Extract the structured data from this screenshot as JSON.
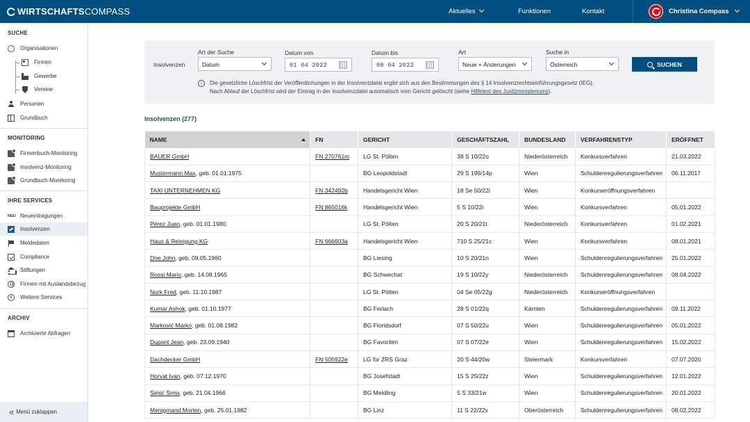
{
  "app": {
    "logo_bold": "WIRTSCHAFTS",
    "logo_light": "COMPASS"
  },
  "topnav": {
    "aktuelles": "Aktuelles",
    "funktionen": "Funktionen",
    "kontakt": "Kontakt",
    "user_name": "Christina Compass"
  },
  "sidebar": {
    "suche_head": "SUCHE",
    "organisationen": "Organisationen",
    "firmen": "Firmen",
    "gewerbe": "Gewerbe",
    "vereine": "Vereine",
    "personen": "Personen",
    "grundbuch": "Grundbuch",
    "monitoring_head": "MONITORING",
    "firmenbuch_monitoring": "Firmenbuch-Monitoring",
    "insolvenz_monitoring": "Insolvenz-Monitoring",
    "grundbuch_monitoring": "Grundbuch-Monitoring",
    "services_head": "IHRE SERVICES",
    "neu_badge": "NEU",
    "neueintragungen": "Neueintragungen",
    "insolvenzen": "Insolvenzen",
    "meldedaten": "Meldedaten",
    "compliance": "Compliance",
    "stiftungen": "Stiftungen",
    "auslandsbezug": "Firmen mit Auslandsbezug",
    "weitere": "Weitere Services",
    "archiv_head": "ARCHIV",
    "archivierte": "Archivierte Abfragen",
    "collapse": "Menü zuklappen"
  },
  "search": {
    "panel_label": "Insolvenzen",
    "art_der_suche_label": "Art der Suche",
    "art_der_suche_value": "Datum",
    "datum_von_label": "Datum von",
    "datum_von_value": "01  04  2022",
    "datum_bis_label": "Datum bis",
    "datum_bis_value": "08  04  2022",
    "art_label": "Art",
    "art_value": "Neue + Änderungen",
    "suche_in_label": "Suche in",
    "suche_in_value": "Österreich",
    "button": "SUCHEN",
    "info_line1": "Die gesetzliche Löschfrist der Veröffentlichungen in der Insolvenzdatei ergibt sich aus den Bestimmungen des § 14 Insolvenzrechtseinführungsgesetz (IEG).",
    "info_line2_prefix": "Nach Ablauf der Löschfrist wird der Eintrag in der Insolvenzdatei automatisch vom Gericht gelöscht (siehe ",
    "info_link": "Hilfetext des Justizministeriums",
    "info_line2_suffix": ")."
  },
  "results": {
    "title": "Insolvenzen (277)",
    "columns": [
      "NAME",
      "FN",
      "GERICHT",
      "GESCHÄFTSZAHL",
      "BUNDESLAND",
      "VERFAHRENSTYP",
      "ERÖFFNET"
    ],
    "rows": [
      {
        "name": "BAUER GmbH",
        "name_suffix": "",
        "fn": "FN 270761m",
        "gericht": "LG St. Pölten",
        "gz": "38 S 10/22o",
        "bl": "Niederösterreich",
        "typ": "Konkursverfahren",
        "date": "21.03.2022"
      },
      {
        "name": "Mustermann Max",
        "name_suffix": ", geb. 01.01.1975",
        "fn": "",
        "gericht": "BG Leopoldstadt",
        "gz": "29 S 199/14p",
        "bl": "Wien",
        "typ": "Schuldenregulierungsverfahren",
        "date": "06.11.2017"
      },
      {
        "name": "TAXI UNTERNEHMEN KG",
        "name_suffix": "",
        "fn": "FN 342492b",
        "gericht": "Handelsgericht Wien",
        "gz": "18 Se 50/22i",
        "bl": "Wien",
        "typ": "Konkurseröffnungsverfahren",
        "date": ""
      },
      {
        "name": "Bauprojekte GmbH",
        "name_suffix": "",
        "fn": "FN 865016k",
        "gericht": "Handelsgericht Wien",
        "gz": "5 S 10/22i",
        "bl": "Wien",
        "typ": "Konkursverfahren",
        "date": "05.01.2022"
      },
      {
        "name": "Pérez Juan",
        "name_suffix": ", geb. 01.01.1980",
        "fn": "",
        "gericht": "LG St. Pölten",
        "gz": "20 S 20/21t",
        "bl": "Niederösterreich",
        "typ": "Konkursverfahren",
        "date": "01.02.2021"
      },
      {
        "name": "Haus & Reinigung KG",
        "name_suffix": "",
        "fn": "FN 666603a",
        "gericht": "Handelsgericht Wien",
        "gz": "710 S 25/21c",
        "bl": "Wien",
        "typ": "Konkursverfahren",
        "date": "08.01.2021"
      },
      {
        "name": "Doe John",
        "name_suffix": ", geb. 09.05.1960",
        "fn": "",
        "gericht": "BG Liesing",
        "gz": "10 S 20/21n",
        "bl": "Wien",
        "typ": "Schuldenregulierungsverfahren",
        "date": "25.01.2022"
      },
      {
        "name": "Rossi Mario",
        "name_suffix": ", geb. 14.08.1965",
        "fn": "",
        "gericht": "BG Schwechat",
        "gz": "19 S 10/22y",
        "bl": "Niederösterreich",
        "typ": "Schuldenregulierungsverfahren",
        "date": "08.04.2022"
      },
      {
        "name": "Nurk Fred",
        "name_suffix": ", geb. 11.10.1987",
        "fn": "",
        "gericht": "LG St. Pölten",
        "gz": "04 Se 05/22g",
        "bl": "Niederösterreich",
        "typ": "Konkurseröffnungsverfahren",
        "date": ""
      },
      {
        "name": "Kumar Ashok",
        "name_suffix": ", geb. 01.10.1977",
        "fn": "",
        "gericht": "BG Ferlach",
        "gz": "28 S 01/22q",
        "bl": "Kärnten",
        "typ": "Schuldenregulierungsverfahren",
        "date": "09.11.2022"
      },
      {
        "name": "Marković Marko",
        "name_suffix": ", geb. 01.08.1982",
        "fn": "",
        "gericht": "BG Floridsdorf",
        "gz": "07 S 50/22u",
        "bl": "Wien",
        "typ": "Schuldenregulierungsverfahren",
        "date": "05.01.2022"
      },
      {
        "name": "Dupont Jean",
        "name_suffix": ", geb. 23.09.1940",
        "fn": "",
        "gericht": "BG Favoriten",
        "gz": "07 S 07/22e",
        "bl": "Wien",
        "typ": "Schuldenregulierungsverfahren",
        "date": "15.02.2022"
      },
      {
        "name": "Dachdecker GmbH",
        "name_suffix": "",
        "fn": "FN 505922e",
        "gericht": "LG für ZRS Graz",
        "gz": "20 S 44/20w",
        "bl": "Steiermark",
        "typ": "Konkursverfahren",
        "date": "07.07.2020"
      },
      {
        "name": "Horvat Ivan",
        "name_suffix": ", geb. 07.12.1970",
        "fn": "",
        "gericht": "BG Josefstadt",
        "gz": "15 S 25/22z",
        "bl": "Wien",
        "typ": "Schuldenregulierungsverfahren",
        "date": "12.01.2022"
      },
      {
        "name": "Simić Sima",
        "name_suffix": ", geb. 21.04.1966",
        "fn": "",
        "gericht": "BG Meidling",
        "gz": "5 S 33/21w",
        "bl": "Wien",
        "typ": "Schuldenregulierungsverfahren",
        "date": "20.01.2022"
      },
      {
        "name": "Menigmand Morten",
        "name_suffix": ", geb. 25.01.1982",
        "fn": "",
        "gericht": "BG Linz",
        "gz": "11 S 22/22x",
        "bl": "Oberösterreich",
        "typ": "Schuldenregulierungsverfahren",
        "date": "08.02.2022"
      }
    ]
  },
  "colors": {
    "brand": "#004e80",
    "accent_red": "#e3001b",
    "panel_bg": "#eff1f3"
  }
}
